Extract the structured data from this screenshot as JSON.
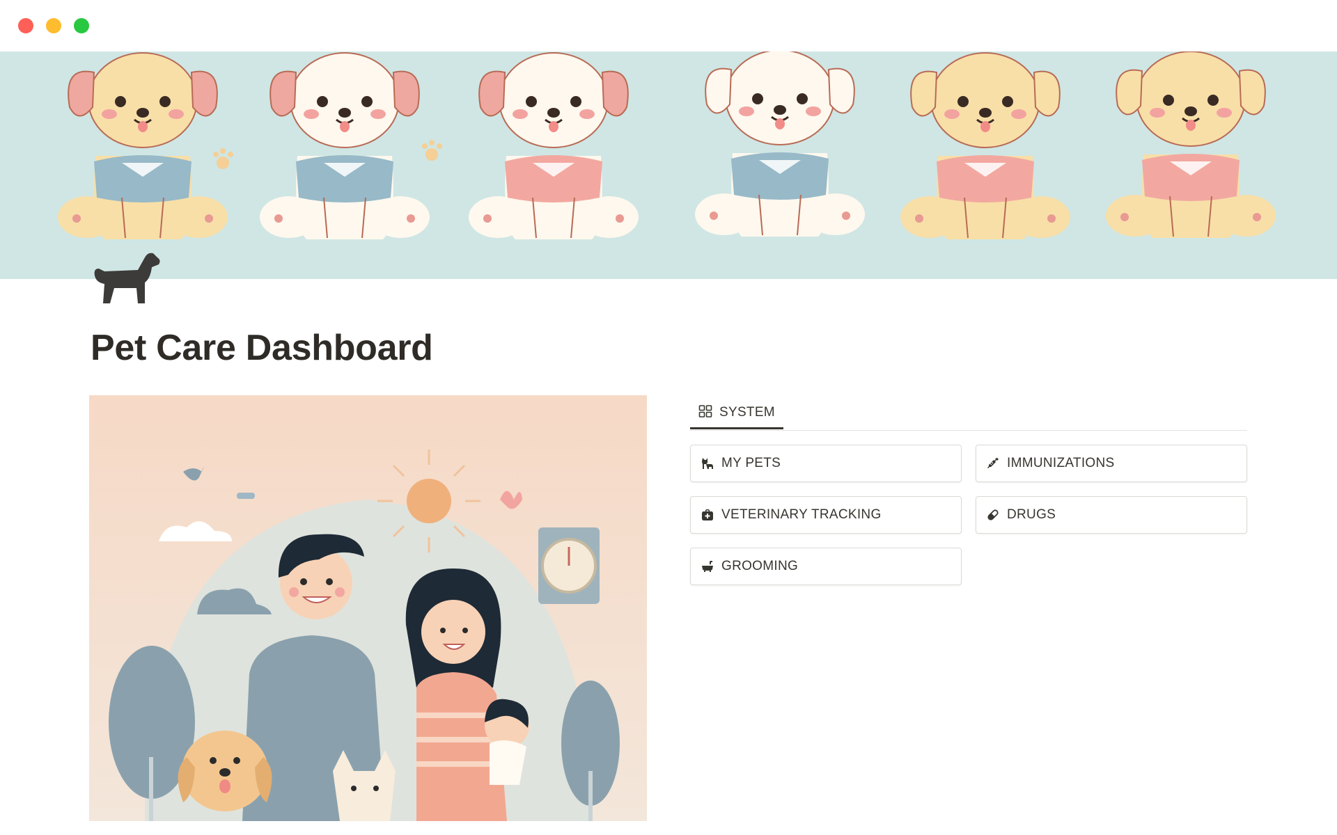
{
  "window": {
    "colors": {
      "close": "#fe5f57",
      "minimize": "#febc2e",
      "zoom": "#28c840"
    }
  },
  "cover": {
    "background": "#cfe6e4"
  },
  "page": {
    "icon": "dog-icon",
    "title": "Pet Care Dashboard"
  },
  "tabs": [
    {
      "label": "SYSTEM",
      "icon": "grid-icon",
      "active": true
    }
  ],
  "buttons": [
    {
      "label": "MY PETS",
      "icon": "cat-icon"
    },
    {
      "label": "IMMUNIZATIONS",
      "icon": "syringe-icon"
    },
    {
      "label": "VETERINARY TRACKING",
      "icon": "medical-bag-icon"
    },
    {
      "label": "DRUGS",
      "icon": "pill-icon"
    },
    {
      "label": "GROOMING",
      "icon": "bathtub-icon"
    }
  ]
}
